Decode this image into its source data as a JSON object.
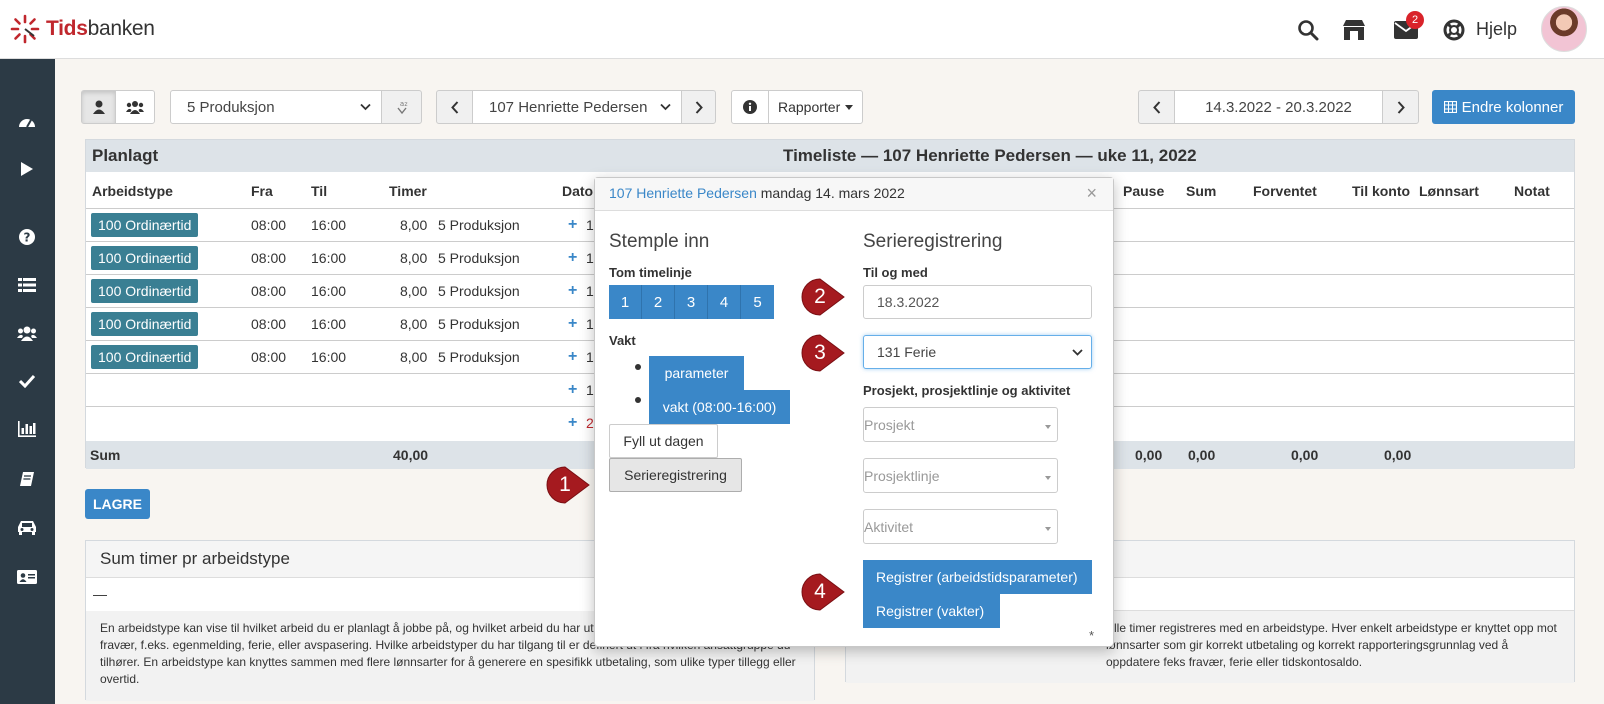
{
  "brand": {
    "name_red": "Tids",
    "name_dark": "banken",
    "accent": "#c0272d"
  },
  "header": {
    "help_label": "Hjelp",
    "mail_badge": "2"
  },
  "toolbar": {
    "department": "5 Produksjon",
    "employee": "107 Henriette Pedersen",
    "reports": "Rapporter",
    "date_range": "14.3.2022 - 20.3.2022",
    "edit_columns": "Endre kolonner"
  },
  "panel": {
    "left_title": "Planlagt",
    "main_title": "Timeliste — 107 Henriette Pedersen — uke 11, 2022",
    "columns": [
      "Arbeidstype",
      "Fra",
      "Til",
      "Timer",
      "Dato",
      "Pause",
      "Sum",
      "Forventet",
      "Til konto",
      "Lønnsart",
      "Notat"
    ],
    "rows": [
      {
        "type": "100 Ordinærtid",
        "from": "08:00",
        "to": "16:00",
        "hours": "8,00",
        "dept": "5 Produksjon",
        "date": "1"
      },
      {
        "type": "100 Ordinærtid",
        "from": "08:00",
        "to": "16:00",
        "hours": "8,00",
        "dept": "5 Produksjon",
        "date": "1"
      },
      {
        "type": "100 Ordinærtid",
        "from": "08:00",
        "to": "16:00",
        "hours": "8,00",
        "dept": "5 Produksjon",
        "date": "1"
      },
      {
        "type": "100 Ordinærtid",
        "from": "08:00",
        "to": "16:00",
        "hours": "8,00",
        "dept": "5 Produksjon",
        "date": "1"
      },
      {
        "type": "100 Ordinærtid",
        "from": "08:00",
        "to": "16:00",
        "hours": "8,00",
        "dept": "5 Produksjon",
        "date": "1"
      }
    ],
    "extra_dates": [
      "1",
      "2"
    ],
    "sum_label": "Sum",
    "sum_hours": "40,00",
    "sum_values": [
      "0,00",
      "0,00",
      "0,00",
      "0,00"
    ]
  },
  "save_label": "LAGRE",
  "box_left": {
    "title": "Sum timer pr arbeidstype",
    "dash": "—",
    "desc": "En arbeidstype kan vise til hvilket arbeid du er planlagt å jobbe på, og hvilket arbeid du har utført. En arbeidstype kan også vise til fravær, f.eks. egenmelding, ferie, eller avspasering. Hvilke arbeidstyper du har tilgang til er definert ut i fra hvilken ansattgruppe du tilhører. En arbeidstype kan knyttes sammen med flere lønnsarter for å generere en spesifikk utbetaling, som ulike typer tillegg eller overtid."
  },
  "box_right": {
    "desc": "Alle timer registreres med en arbeidstype. Hver enkelt arbeidstype er knyttet opp mot lønnsarter som gir korrekt utbetaling og korrekt rapporteringsgrunnlag ved å oppdatere feks fravær, ferie eller tidskontosaldo."
  },
  "popup": {
    "name_link": "107 Henriette Pedersen",
    "date_text": "mandag 14. mars 2022",
    "close": "×",
    "left_title": "Stemple inn",
    "empty_line_label": "Tom timelinje",
    "numbers": [
      "1",
      "2",
      "3",
      "4",
      "5"
    ],
    "shift_label": "Vakt",
    "shift_items": [
      "parameter",
      "vakt (08:00-16:00)"
    ],
    "fill_day": "Fyll ut dagen",
    "series_btn": "Serieregistrering",
    "right_title": "Serieregistrering",
    "until_label": "Til og med",
    "until_value": "18.3.2022",
    "worktype_value": "131 Ferie",
    "project_label": "Prosjekt, prosjektlinje og aktivitet",
    "project_placeholder": "Prosjekt",
    "project_line_placeholder": "Prosjektlinje",
    "activity_placeholder": "Aktivitet",
    "register_param": "Registrer (arbeidstidsparameter)",
    "register_shifts": "Registrer (vakter)",
    "asterisk": "*"
  },
  "markers": [
    "1",
    "2",
    "3",
    "4"
  ],
  "colors": {
    "primary": "#3a87c8",
    "tag": "#3a7f93",
    "sidebar": "#2c3a45",
    "marker": "#a51a1f"
  }
}
